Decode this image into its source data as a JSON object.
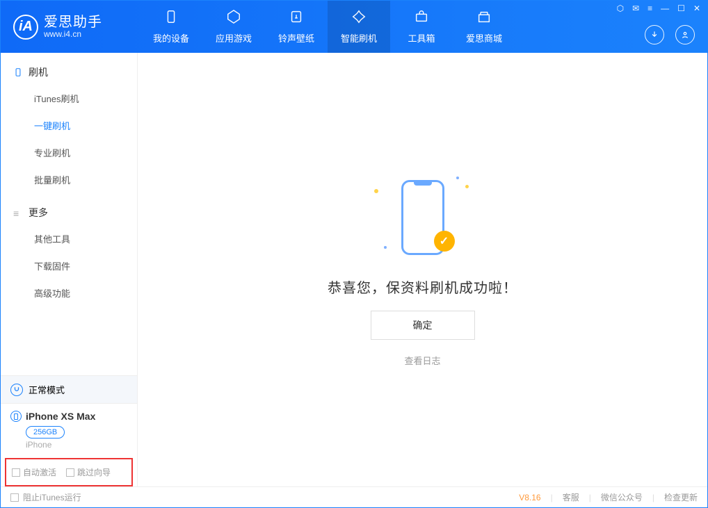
{
  "app": {
    "name": "爱思助手",
    "site": "www.i4.cn",
    "logo_letter": "iA"
  },
  "tabs": [
    {
      "label": "我的设备",
      "icon": "device-icon"
    },
    {
      "label": "应用游戏",
      "icon": "apps-icon"
    },
    {
      "label": "铃声壁纸",
      "icon": "ringtone-icon"
    },
    {
      "label": "智能刷机",
      "icon": "flash-icon",
      "active": true
    },
    {
      "label": "工具箱",
      "icon": "toolbox-icon"
    },
    {
      "label": "爱思商城",
      "icon": "store-icon"
    }
  ],
  "sidebar": {
    "section1": {
      "title": "刷机"
    },
    "items1": [
      "iTunes刷机",
      "一键刷机",
      "专业刷机",
      "批量刷机"
    ],
    "active1_index": 1,
    "section2": {
      "title": "更多"
    },
    "items2": [
      "其他工具",
      "下载固件",
      "高级功能"
    ]
  },
  "device_mode": "正常模式",
  "device": {
    "name": "iPhone XS Max",
    "storage": "256GB",
    "type": "iPhone"
  },
  "options": {
    "auto_activate": "自动激活",
    "skip_guide": "跳过向导"
  },
  "main": {
    "success": "恭喜您，保资料刷机成功啦！",
    "ok": "确定",
    "view_log": "查看日志"
  },
  "footer": {
    "block_itunes": "阻止iTunes运行",
    "version": "V8.16",
    "support": "客服",
    "wechat": "微信公众号",
    "check_update": "检查更新"
  }
}
